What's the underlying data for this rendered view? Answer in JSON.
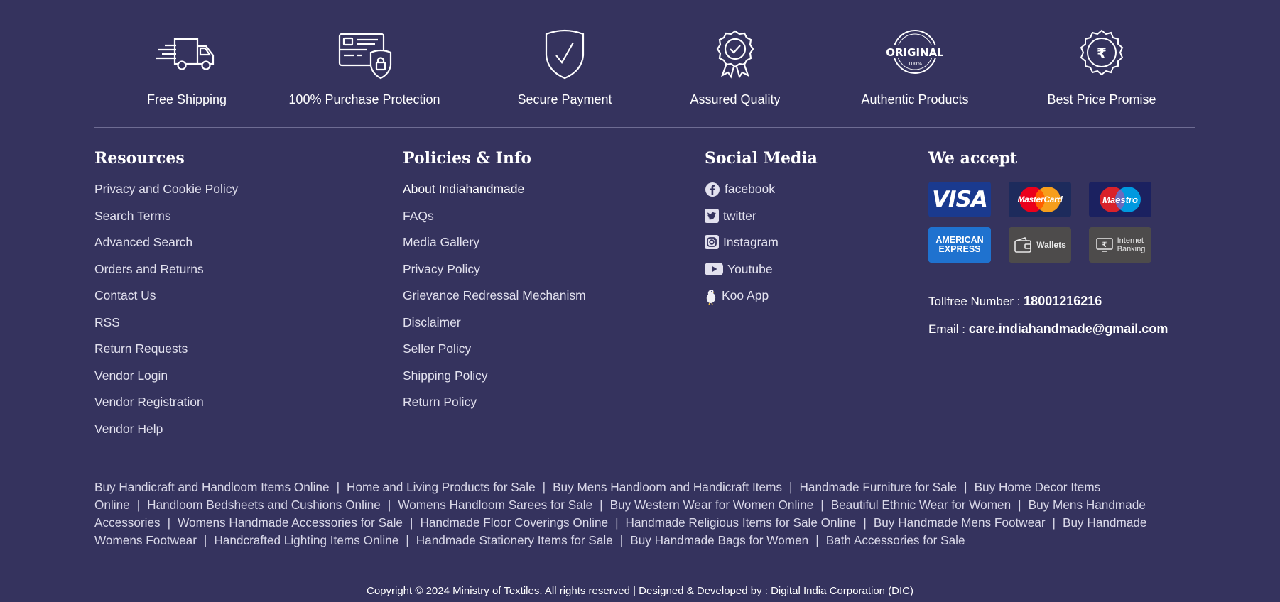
{
  "features": [
    {
      "label": "Free Shipping",
      "icon": "truck-icon"
    },
    {
      "label": "100% Purchase Protection",
      "icon": "card-lock-icon"
    },
    {
      "label": "Secure Payment",
      "icon": "shield-check-icon"
    },
    {
      "label": "Assured Quality",
      "icon": "quality-badge-icon"
    },
    {
      "label": "Authentic Products",
      "icon": "original-stamp-icon"
    },
    {
      "label": "Best Price Promise",
      "icon": "best-price-badge-icon"
    }
  ],
  "resources": {
    "heading": "Resources",
    "items": [
      "Privacy and Cookie Policy",
      "Search Terms",
      "Advanced Search",
      "Orders and Returns",
      "Contact Us",
      "RSS",
      "Return Requests",
      "Vendor Login",
      "Vendor Registration",
      "Vendor Help"
    ]
  },
  "policies": {
    "heading": "Policies & Info",
    "items": [
      "About Indiahandmade",
      "FAQs",
      "Media Gallery",
      "Privacy Policy",
      "Grievance Redressal Mechanism",
      "Disclaimer",
      "Seller Policy",
      "Shipping Policy",
      "Return Policy"
    ]
  },
  "social": {
    "heading": "Social Media",
    "items": [
      {
        "label": "facebook",
        "icon": "facebook-icon"
      },
      {
        "label": "twitter",
        "icon": "twitter-icon"
      },
      {
        "label": "Instagram",
        "icon": "instagram-icon"
      },
      {
        "label": "Youtube",
        "icon": "youtube-icon"
      },
      {
        "label": "Koo App",
        "icon": "koo-icon"
      }
    ]
  },
  "payments": {
    "heading": "We accept",
    "cards": {
      "visa": "VISA",
      "mastercard": "MasterCard",
      "maestro": "Maestro",
      "amex_line1": "AMERICAN",
      "amex_line2": "EXPRESS",
      "wallets": "Wallets",
      "netbanking_line1": "Internet",
      "netbanking_line2": "Banking"
    },
    "tollfree_label": "Tollfree Number : ",
    "tollfree_value": "18001216216",
    "email_label": "Email : ",
    "email_value": "care.indiahandmade@gmail.com"
  },
  "seo_links": [
    "Buy Handicraft and Handloom Items Online",
    "Home and Living Products for Sale",
    "Buy Mens Handloom and Handicraft Items",
    "Handmade Furniture for Sale",
    "Buy Home Decor Items Online",
    "Handloom Bedsheets and Cushions Online",
    "Womens Handloom Sarees for Sale",
    "Buy Western Wear for Women Online",
    "Beautiful Ethnic Wear for Women",
    "Buy Mens Handmade Accessories",
    "Womens Handmade Accessories for Sale",
    "Handmade Floor Coverings Online",
    "Handmade Religious Items for Sale Online",
    "Buy Handmade Mens Footwear",
    "Buy Handmade Womens Footwear",
    "Handcrafted Lighting Items Online",
    "Handmade Stationery Items for Sale",
    "Buy Handmade Bags for Women",
    "Bath Accessories for Sale"
  ],
  "copyright": "Copyright © 2024 Ministry of Textiles. All rights reserved | Designed & Developed by : Digital India Corporation (DIC)",
  "colors": {
    "background": "#35335e",
    "visa": "#1a3a8f",
    "mastercard": "#1d2b5c",
    "maestro": "#1b2160",
    "amex": "#1f72cf",
    "wallets": "#4d4b4b",
    "netbanking": "#4d4b4b"
  }
}
